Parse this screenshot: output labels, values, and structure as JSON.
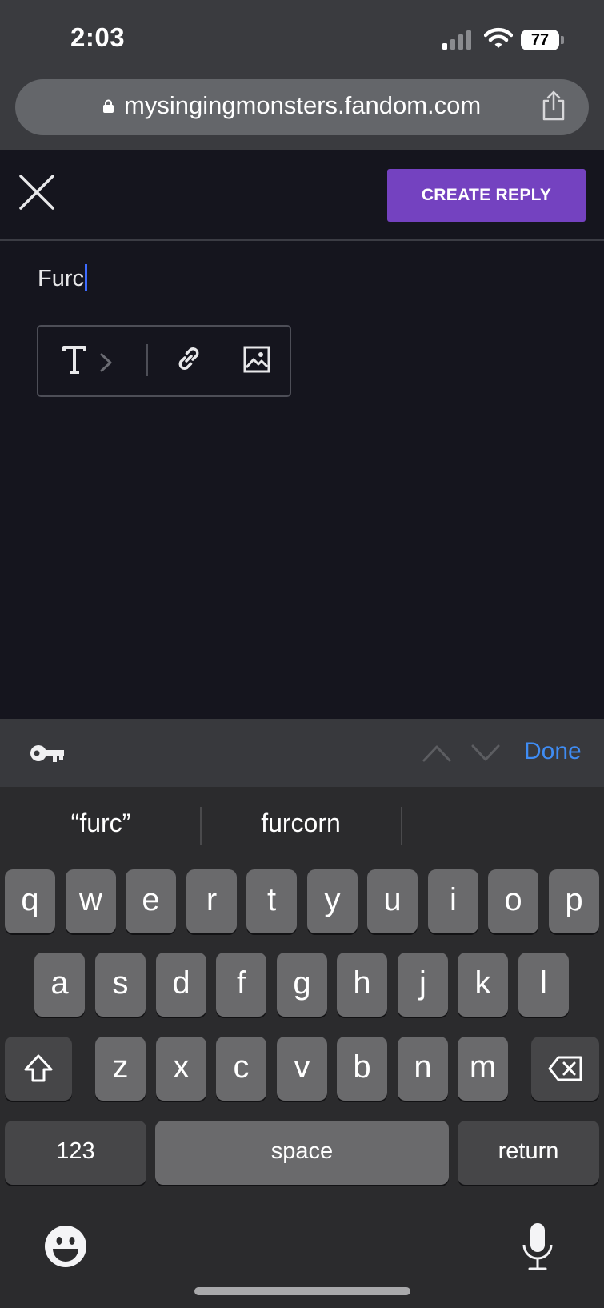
{
  "status_bar": {
    "time": "2:03",
    "battery": "77"
  },
  "url_bar": {
    "domain": "mysingingmonsters.fandom.com"
  },
  "header": {
    "create_reply_label": "CREATE REPLY"
  },
  "editor": {
    "text": "Furc"
  },
  "accessory": {
    "done_label": "Done"
  },
  "suggestions": [
    "“furc”",
    "furcorn"
  ],
  "keyboard": {
    "row1": [
      "q",
      "w",
      "e",
      "r",
      "t",
      "y",
      "u",
      "i",
      "o",
      "p"
    ],
    "row2": [
      "a",
      "s",
      "d",
      "f",
      "g",
      "h",
      "j",
      "k",
      "l"
    ],
    "row3": [
      "z",
      "x",
      "c",
      "v",
      "b",
      "n",
      "m"
    ],
    "numbers_label": "123",
    "space_label": "space",
    "return_label": "return"
  },
  "colors": {
    "accent_button": "#7442c0",
    "done_blue": "#3f8cf3",
    "caret": "#3d6bff"
  },
  "icons": [
    "lock-icon",
    "share-icon",
    "close-icon",
    "text-format-icon",
    "chevron-right-icon",
    "link-icon",
    "image-icon",
    "key-icon",
    "chevron-up-icon",
    "chevron-down-icon",
    "shift-icon",
    "backspace-icon",
    "emoji-icon",
    "microphone-icon"
  ]
}
